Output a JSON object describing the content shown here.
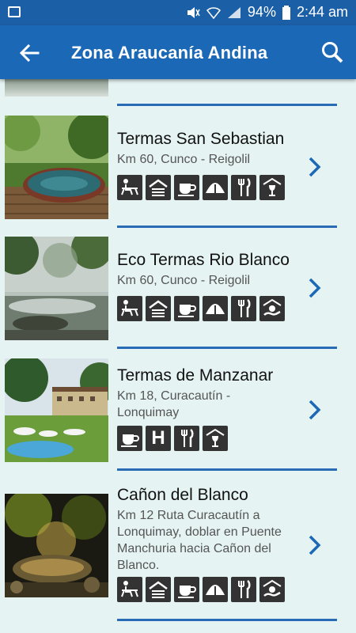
{
  "status": {
    "battery": "94%",
    "time": "2:44 am"
  },
  "appbar": {
    "title": "Zona Araucanía Andina"
  },
  "items": [
    {
      "name": "Termas San Sebastian",
      "location": "Km 60, Cunco - Reigolil",
      "amenities": [
        "picnic-icon",
        "cabin-icon",
        "coffee-icon",
        "camping-icon",
        "restaurant-icon",
        "wine-icon"
      ]
    },
    {
      "name": "Eco Termas Rio Blanco",
      "location": "Km 60, Cunco - Reigolil",
      "amenities": [
        "picnic-icon",
        "cabin-icon",
        "coffee-icon",
        "camping-icon",
        "restaurant-icon",
        "tourism-icon"
      ]
    },
    {
      "name": "Termas de Manzanar",
      "location": "Km 18, Curacautín - Lonquimay",
      "amenities": [
        "coffee-icon",
        "hotel-icon",
        "restaurant-icon",
        "wine-icon"
      ]
    },
    {
      "name": "Cañon del Blanco",
      "location": "Km 12 Ruta Curacautín a Lonquimay, doblar en Puente Manchuria hacia Cañon del Blanco.",
      "amenities": [
        "picnic-icon",
        "cabin-icon",
        "coffee-icon",
        "camping-icon",
        "restaurant-icon",
        "tourism-icon"
      ]
    }
  ],
  "hotel_letter": "H"
}
